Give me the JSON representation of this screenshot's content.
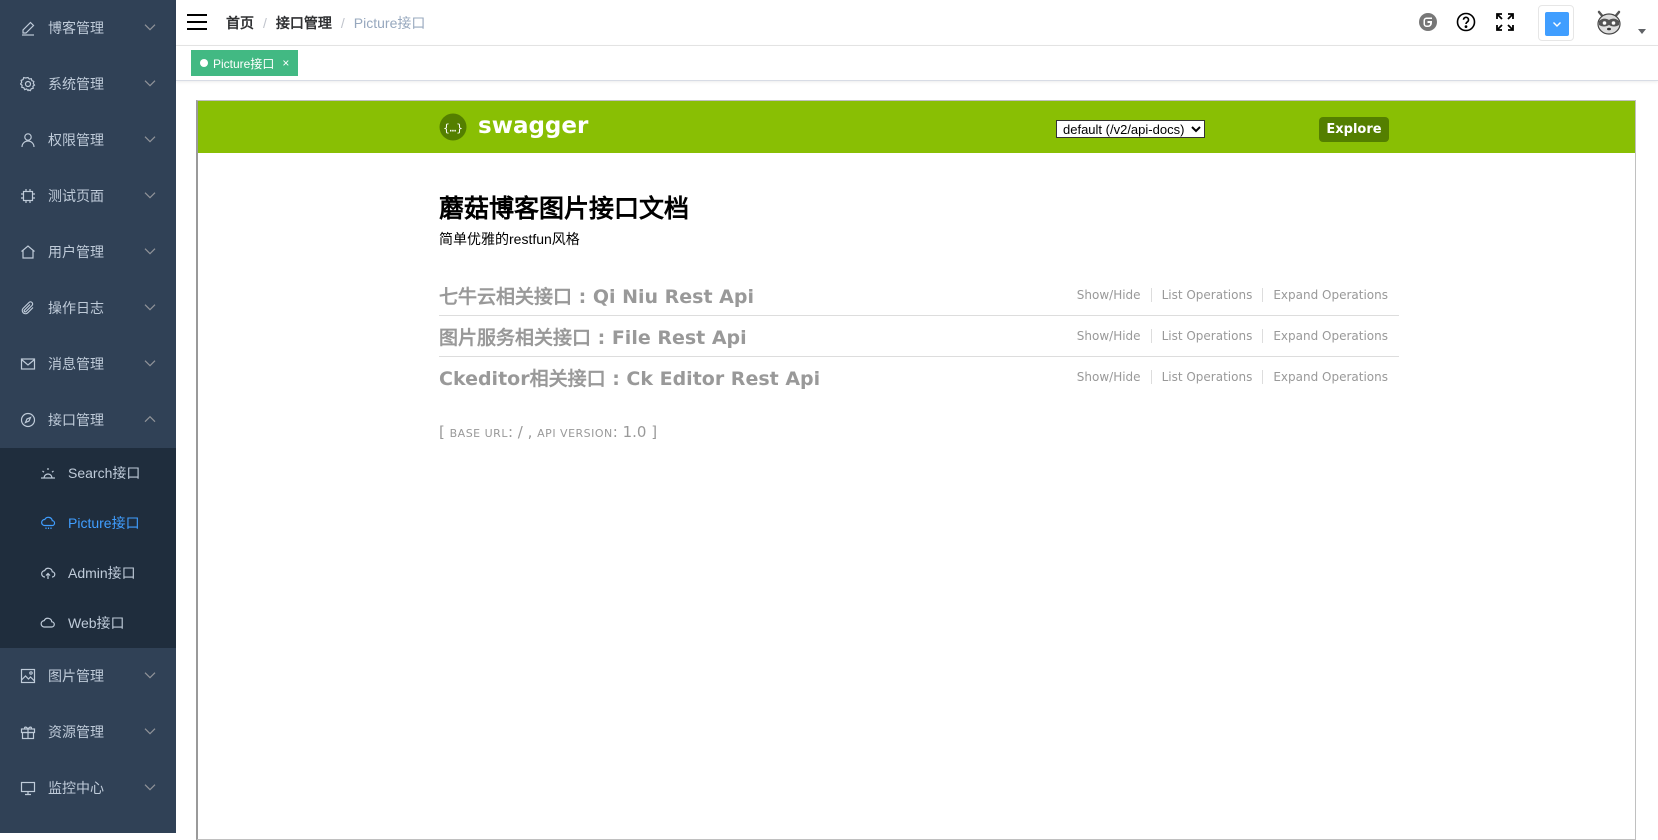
{
  "sidebar": {
    "items": [
      {
        "label": "博客管理",
        "icon": "edit-icon",
        "expanded": false
      },
      {
        "label": "系统管理",
        "icon": "gear-icon",
        "expanded": false
      },
      {
        "label": "权限管理",
        "icon": "user-icon",
        "expanded": false
      },
      {
        "label": "测试页面",
        "icon": "chip-icon",
        "expanded": false
      },
      {
        "label": "用户管理",
        "icon": "home-icon",
        "expanded": false
      },
      {
        "label": "操作日志",
        "icon": "paperclip-icon",
        "expanded": false
      },
      {
        "label": "消息管理",
        "icon": "mail-icon",
        "expanded": false
      },
      {
        "label": "接口管理",
        "icon": "compass-icon",
        "expanded": true
      },
      {
        "label": "图片管理",
        "icon": "picture-icon",
        "expanded": false
      },
      {
        "label": "资源管理",
        "icon": "gift-icon",
        "expanded": false
      },
      {
        "label": "监控中心",
        "icon": "monitor-icon",
        "expanded": false
      }
    ],
    "submenu": [
      {
        "label": "Search接口",
        "icon": "sunrise-icon",
        "active": false
      },
      {
        "label": "Picture接口",
        "icon": "cloud-rain-icon",
        "active": true
      },
      {
        "label": "Admin接口",
        "icon": "cloud-upload-icon",
        "active": false
      },
      {
        "label": "Web接口",
        "icon": "cloud-icon",
        "active": false
      }
    ]
  },
  "navbar": {
    "breadcrumb": [
      "首页",
      "接口管理",
      "Picture接口"
    ],
    "separator": "/",
    "icons": [
      "gitee-icon",
      "help-icon",
      "fullscreen-icon"
    ],
    "theme_color": "#409eff"
  },
  "tags": [
    {
      "label": "Picture接口",
      "close": "×",
      "active": true
    }
  ],
  "swagger": {
    "logo_text": "swagger",
    "select_value": "default (/v2/api-docs)",
    "explore_label": "Explore",
    "title": "蘑菇博客图片接口文档",
    "description": "简单优雅的restfun风格",
    "resources": [
      {
        "title": "七牛云相关接口 : Qi Niu Rest Api"
      },
      {
        "title": "图片服务相关接口 : File Rest Api"
      },
      {
        "title": "Ckeditor相关接口 : Ck Editor Rest Api"
      }
    ],
    "ops": {
      "show_hide": "Show/Hide",
      "list": "List Operations",
      "expand": "Expand Operations"
    },
    "base_url_label": "base url",
    "base_url_value": "/",
    "api_version_label": "api version",
    "api_version_value": "1.0"
  },
  "colors": {
    "sidebar_bg": "#304156",
    "submenu_bg": "#1f2d3d",
    "active": "#409eff",
    "tag": "#42b983",
    "swagger_green": "#89bf04"
  }
}
